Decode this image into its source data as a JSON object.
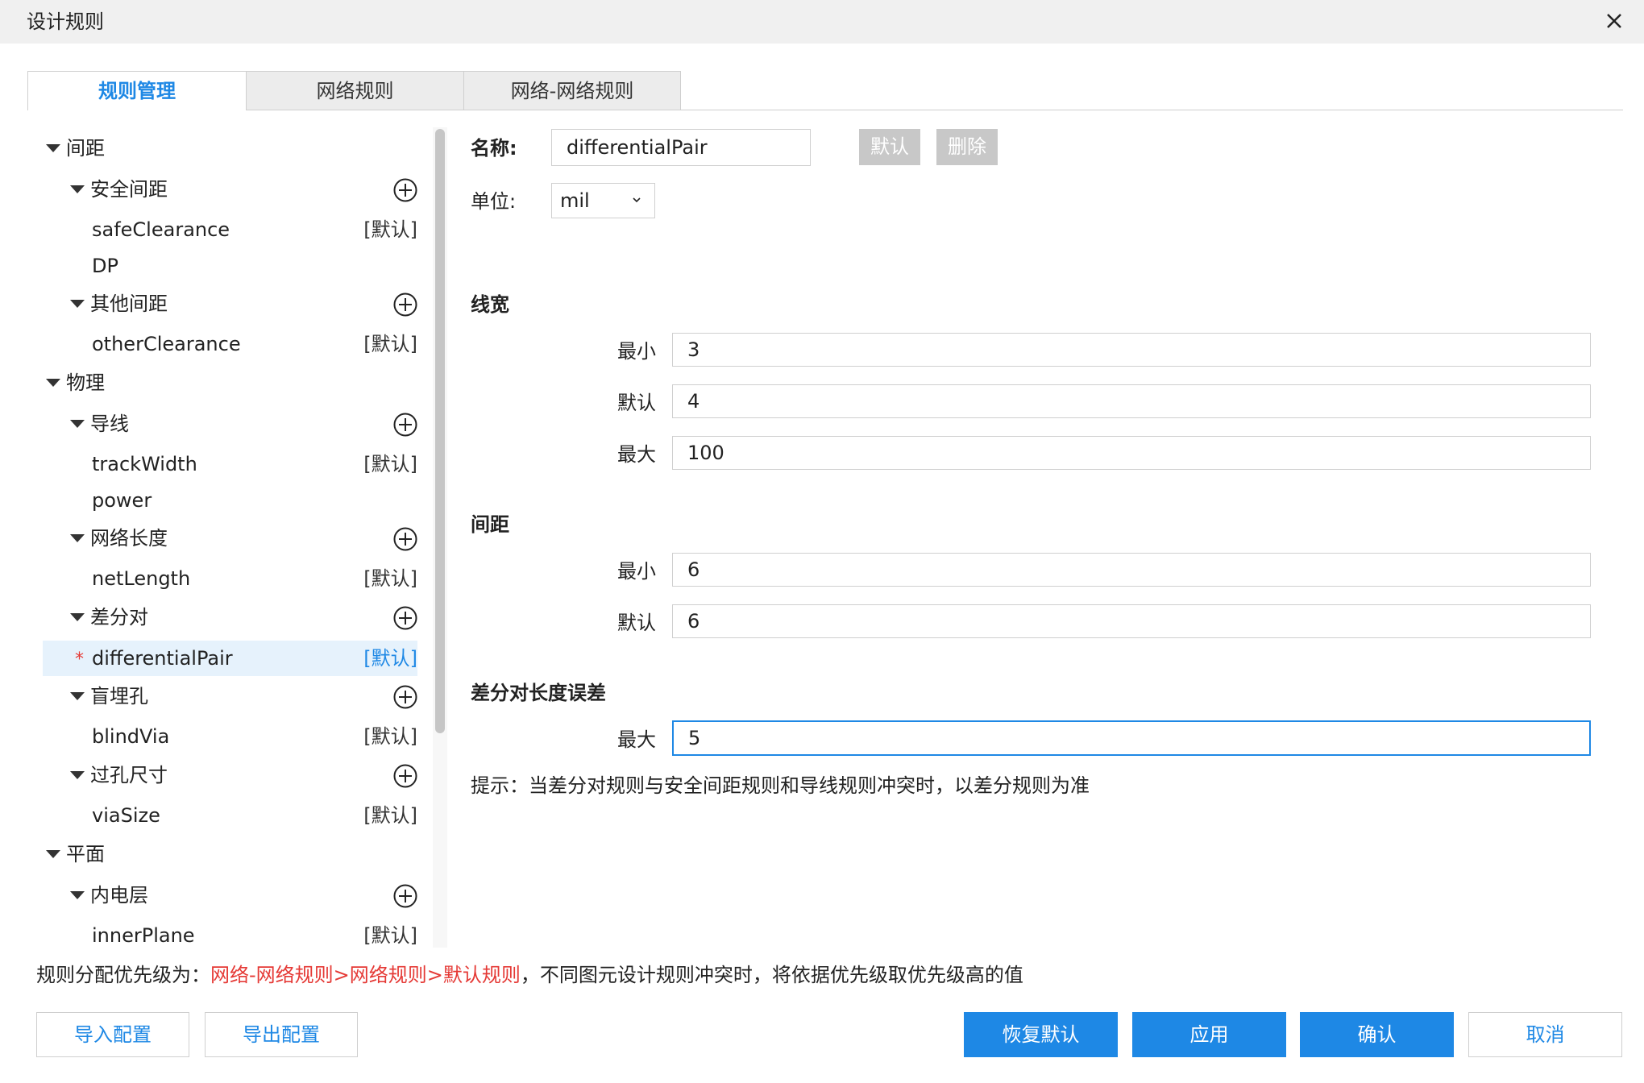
{
  "window": {
    "title": "设计规则"
  },
  "tabs": [
    {
      "label": "规则管理",
      "active": true
    },
    {
      "label": "网络规则",
      "active": false
    },
    {
      "label": "网络-网络规则",
      "active": false
    }
  ],
  "tree": {
    "tag_default": "[默认]",
    "groups": {
      "spacing": "间距",
      "physical": "物理",
      "plane": "平面"
    },
    "categories": {
      "safe_spacing": "安全间距",
      "other_spacing": "其他间距",
      "track": "导线",
      "net_length": "网络长度",
      "diff_pair": "差分对",
      "blind_via": "盲埋孔",
      "via_size": "过孔尺寸",
      "inner_layer": "内电层"
    },
    "rules": {
      "safeClearance": "safeClearance",
      "DP": "DP",
      "otherClearance": "otherClearance",
      "trackWidth": "trackWidth",
      "power": "power",
      "netLength": "netLength",
      "differentialPair": "differentialPair",
      "blindVia": "blindVia",
      "viaSize": "viaSize",
      "innerPlane": "innerPlane"
    },
    "modified_marker": "*"
  },
  "form": {
    "name_label": "名称:",
    "name_value": "differentialPair",
    "default_btn": "默认",
    "delete_btn": "删除",
    "unit_label": "单位:",
    "unit_value": "mil",
    "track_width": {
      "title": "线宽",
      "min_label": "最小",
      "min_value": "3",
      "default_label": "默认",
      "default_value": "4",
      "max_label": "最大",
      "max_value": "100"
    },
    "spacing": {
      "title": "间距",
      "min_label": "最小",
      "min_value": "6",
      "default_label": "默认",
      "default_value": "6"
    },
    "length_tolerance": {
      "title": "差分对长度误差",
      "max_label": "最大",
      "max_value": "5"
    },
    "hint": "提示：当差分对规则与安全间距规则和导线规则冲突时，以差分规则为准"
  },
  "footer": {
    "note_prefix": "规则分配优先级为：",
    "note_priority": "网络-网络规则>网络规则>默认规则",
    "note_suffix": "，不同图元设计规则冲突时，将依据优先级取优先级高的值",
    "import_btn": "导入配置",
    "export_btn": "导出配置",
    "restore_btn": "恢复默认",
    "apply_btn": "应用",
    "confirm_btn": "确认",
    "cancel_btn": "取消"
  },
  "colors": {
    "accent": "#1e88e5",
    "priority_red": "#e53935",
    "selected_row": "#e6f2fc",
    "disabled_btn": "#c8c8c8"
  }
}
